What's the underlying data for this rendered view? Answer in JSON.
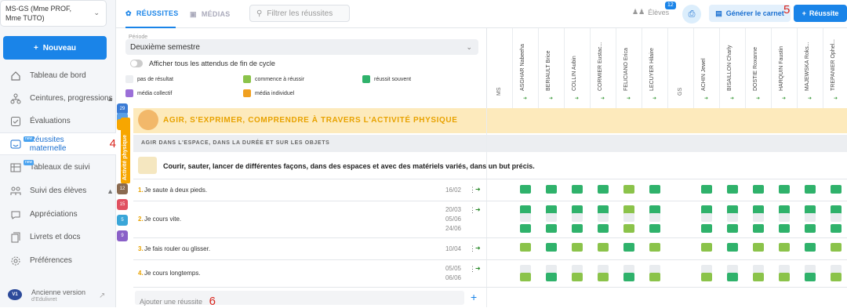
{
  "sidebar": {
    "class_select": "MS-GS (Mme PROF, Mme TUTO)",
    "new_button": "Nouveau",
    "items": [
      {
        "label": "Tableau de bord",
        "icon": "home-icon"
      },
      {
        "label": "Ceintures, progressions",
        "icon": "hierarchy-icon"
      },
      {
        "label": "Évaluations",
        "icon": "check-square-icon"
      },
      {
        "label": "Réussites maternelle",
        "icon": "smile-icon",
        "new": "new"
      },
      {
        "label": "Tableaux de suivi",
        "icon": "table-icon",
        "new": "new"
      },
      {
        "label": "Suivi des élèves",
        "icon": "students-icon"
      },
      {
        "label": "Appréciations",
        "icon": "chat-icon"
      },
      {
        "label": "Livrets et docs",
        "icon": "docs-icon"
      },
      {
        "label": "Préférences",
        "icon": "gear-icon"
      }
    ],
    "annotation_4": "4",
    "old_version": {
      "badge": "V1",
      "title": "Ancienne version",
      "subtitle": "d'Edulivret"
    }
  },
  "topbar": {
    "tab_reussites": "RÉUSSITES",
    "tab_medias": "MÉDIAS",
    "search_placeholder": "Filtrer les réussites",
    "eleves_label": "Élèves",
    "eleves_badge": "12",
    "generate_label": "Générer le carnet",
    "reussite_button": "Réussite",
    "annotation_5": "5"
  },
  "filters": {
    "periode_label": "Période",
    "periode_value": "Deuxième semestre",
    "toggle_label": "Afficher tous les attendus de fin de cycle",
    "legend": {
      "none": "pas de résultat",
      "start": "commence à réussir",
      "often": "réussit souvent",
      "collective": "média collectif",
      "individual": "média individuel"
    }
  },
  "columns": {
    "group_ms": "MS",
    "ms": [
      "ASGHAR Nabeeha",
      "BERIAULT Brice",
      "COLLIN Aubin",
      "CORMIER Eustac...",
      "FELICIANO Erica",
      "LECUYER Hilaire"
    ],
    "group_gs": "GS",
    "gs": [
      "ACHIN Jewel",
      "BISAILLON Charly",
      "DOSTIE Roxanne",
      "HARQUIN Faustin",
      "MAJEWSKA Roks...",
      "TREPANIER Ophel..."
    ]
  },
  "strip_badges": {
    "a": "29",
    "b": "5",
    "c": "12",
    "d": "15",
    "e": "5",
    "f": "9"
  },
  "activite_label": "Activité physique",
  "domain_title": "AGIR, S'EXPRIMER, COMPRENDRE À TRAVERS L'ACTIVITÉ PHYSIQUE",
  "subdomain_title": "AGIR DANS L'ESPACE, DANS LA DURÉE ET SUR LES OBJETS",
  "objective": "Courir, sauter, lancer de différentes façons, dans des espaces et avec des matériels variés, dans un but précis.",
  "rows": [
    {
      "num": "1.",
      "text": "Je saute à deux pieds.",
      "dates": [
        "16/02"
      ]
    },
    {
      "num": "2.",
      "text": "Je cours vite.",
      "dates": [
        "20/03",
        "05/06",
        "24/06"
      ]
    },
    {
      "num": "3.",
      "text": "Je fais rouler ou glisser.",
      "dates": [
        "10/04"
      ]
    },
    {
      "num": "4.",
      "text": "Je cours longtemps.",
      "dates": [
        "05/05",
        "06/06"
      ]
    }
  ],
  "add_placeholder": "Ajouter une réussite",
  "annotation_6": "6",
  "colors": {
    "accent": "#1a84e8",
    "often": "#2fb26b",
    "start": "#8bc34a",
    "domain": "#e8a200"
  }
}
